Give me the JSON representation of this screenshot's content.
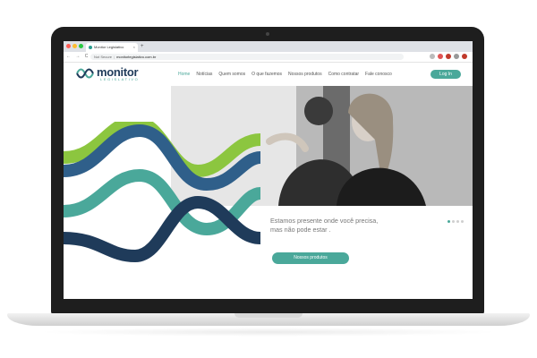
{
  "browser": {
    "tab_title": "Monitor Legislativo",
    "tab_close": "×",
    "new_tab": "+",
    "nav_buttons": "← → C",
    "security_label": "Not Secure",
    "url": "monitorlegislativo.com.br"
  },
  "site": {
    "logo_main": "monitor",
    "logo_sub": "LEGISLATIVO",
    "nav": [
      "Home",
      "Notícias",
      "Quem somos",
      "O que fazemos",
      "Nossos produtos",
      "Como contratar",
      "Fale conosco"
    ],
    "active_nav": "Home",
    "login_label": "Log In"
  },
  "hero": {
    "line1": "Estamos presente onde você precisa,",
    "line2": "mas não pode estar .",
    "cta_label": "Nossos produtos",
    "slides": 4,
    "active_slide": 1
  },
  "colors": {
    "teal": "#4aa89a",
    "navy": "#1f3b5a",
    "green": "#8cc63f",
    "blue": "#2f5f8a"
  },
  "icons": {
    "close": "close-icon",
    "new_tab": "plus-icon",
    "favicon": "site-favicon-icon",
    "extensions": [
      "star-icon",
      "extension-icon",
      "extension-icon",
      "extension-icon",
      "profile-icon"
    ]
  }
}
